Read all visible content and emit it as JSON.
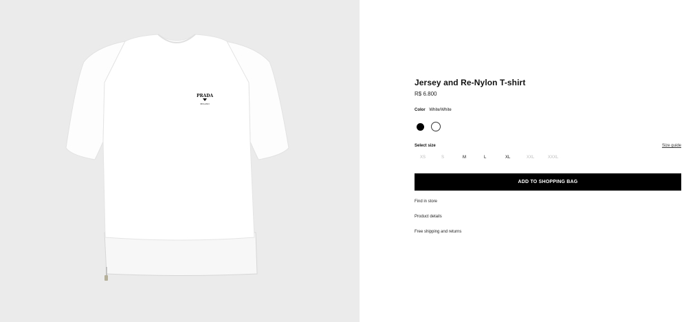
{
  "gallery": {
    "background": "#ebebeb",
    "logo": {
      "line1": "PRADA",
      "line2": "MILANO"
    }
  },
  "product": {
    "title": "Jersey and Re-Nylon T-shirt",
    "price": "R$ 6.800"
  },
  "color": {
    "label": "Color",
    "selected": "White/White",
    "swatches": [
      {
        "name": "Black",
        "hex": "#000000"
      },
      {
        "name": "White",
        "hex": "#ffffff",
        "selected": true
      }
    ]
  },
  "size": {
    "label": "Select size",
    "guide": "Size guide",
    "options": [
      {
        "label": "XS",
        "available": false
      },
      {
        "label": "S",
        "available": false
      },
      {
        "label": "M",
        "available": true
      },
      {
        "label": "L",
        "available": true
      },
      {
        "label": "XL",
        "available": true
      },
      {
        "label": "XXL",
        "available": false
      },
      {
        "label": "XXXL",
        "available": false
      }
    ]
  },
  "actions": {
    "add_to_bag": "ADD TO SHOPPING BAG"
  },
  "links": {
    "find_in_store": "Find in store",
    "product_details": "Product details",
    "shipping": "Free shipping and returns"
  }
}
